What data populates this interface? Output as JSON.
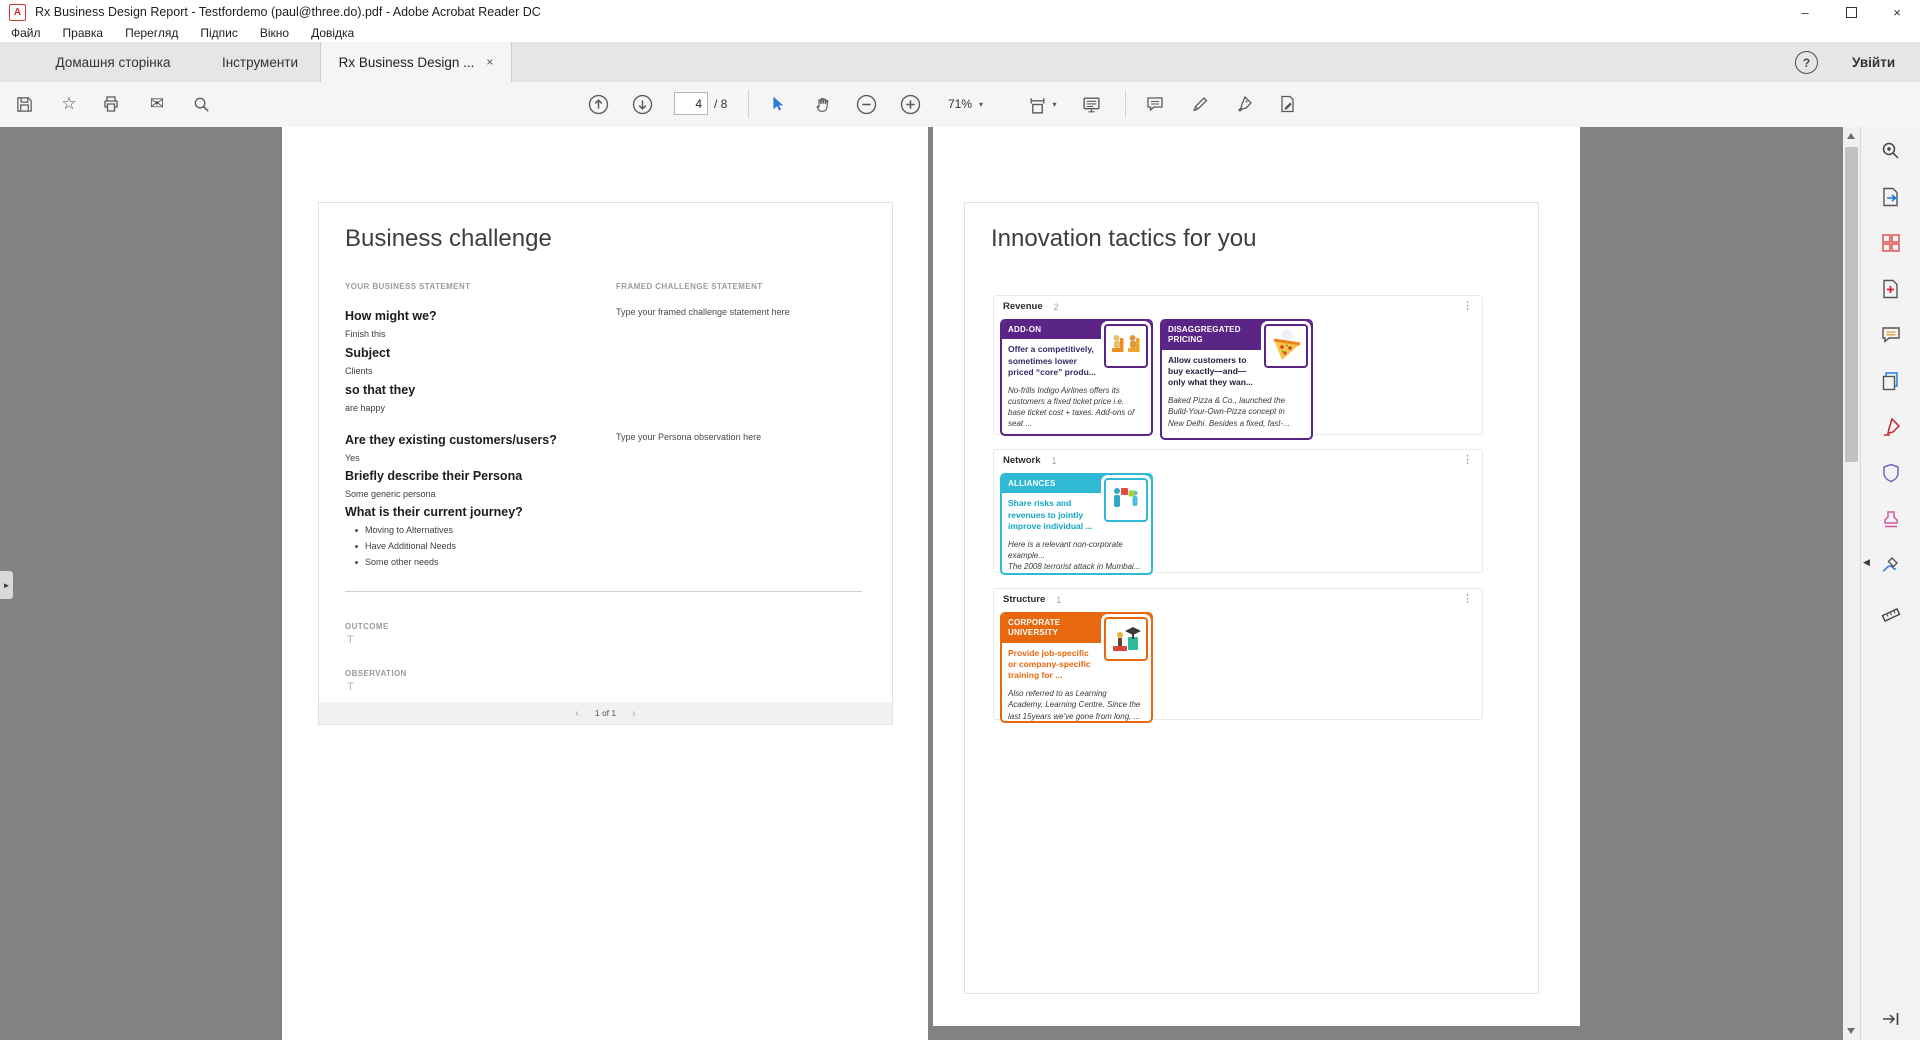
{
  "glyphs": {
    "close": "×",
    "minimize": "–",
    "caret_down": "▾",
    "kebab": "⋮",
    "chevron_left": "‹",
    "chevron_right": "›",
    "help": "?",
    "star": "☆",
    "envelope": "✉",
    "nav_expand": "►",
    "panel_collapse": "◀"
  },
  "colors": {
    "purple": "#5b2487",
    "teal": "#2fb9d4",
    "orange": "#e8680f",
    "doc_background": "#828282"
  },
  "window": {
    "title": "Rx Business Design Report - Testfordemo (paul@three.do).pdf - Adobe Acrobat Reader DC",
    "app_badge": "A"
  },
  "menu": [
    "Файл",
    "Правка",
    "Перегляд",
    "Підпис",
    "Вікно",
    "Довідка"
  ],
  "tabs": {
    "home": "Домашня сторінка",
    "tools": "Інструменти",
    "document": "Rx Business Design ...",
    "sign_in": "Увійти"
  },
  "toolbar": {
    "page": "4",
    "page_total": "/ 8",
    "zoom": "71%"
  },
  "doc": {
    "left_page": {
      "title": "Business challenge",
      "left_label": "YOUR BUSINESS STATEMENT",
      "right_label": "FRAMED CHALLENGE STATEMENT",
      "framed_placeholder": "Type your framed challenge statement here",
      "persona_placeholder": "Type your Persona observation here",
      "q1": "How might we?",
      "a1": "Finish this",
      "q2": "Subject",
      "a2": "Clients",
      "q3": "so that they",
      "a3": "are happy",
      "q4": "Are they existing customers/users?",
      "a4": "Yes",
      "q5": "Briefly describe their Persona",
      "a5": "Some generic persona",
      "q6": "What is their current journey?",
      "bullets": [
        "Moving to Alternatives",
        "Have Additional Needs",
        "Some other needs"
      ],
      "outcome_label": "OUTCOME",
      "outcome_value": "T",
      "observation_label": "OBSERVATION",
      "observation_value": "T",
      "page_indicator": "1 of 1"
    },
    "right_page": {
      "title": "Innovation tactics for you",
      "sections": [
        {
          "name": "Revenue",
          "count": "2"
        },
        {
          "name": "Network",
          "count": "1"
        },
        {
          "name": "Structure",
          "count": "1"
        }
      ],
      "cards": {
        "addon": {
          "header": "ADD-ON",
          "body": "Offer a competitively, sometimes lower priced “core” produ...",
          "example": "No-frills Indigo Airlines offers its customers a fixed ticket price i.e. base ticket cost + taxes. Add-ons of seat ..."
        },
        "disaggregated": {
          "header": "DISAGGREGATED PRICING",
          "body": "Allow customers to buy exactly—and—only what they wan...",
          "example": "Baked Pizza & Co., launched the Build-Your-Own-Pizza concept in New Delhi. Besides a fixed, fast-..."
        },
        "alliances": {
          "header": "ALLIANCES",
          "body": "Share risks and revenues to jointly improve individual ...",
          "example": "Here is a relevant non-corporate example...\nThe 2008 terrorist attack in Mumbai..."
        },
        "corporate": {
          "header": "CORPORATE UNIVERSITY",
          "body": "Provide job-specific or company-specific training for ...",
          "example": "Also referred to as Learning Academy, Learning Centre. Since the last 15years we've gone from long, ..."
        }
      }
    }
  }
}
